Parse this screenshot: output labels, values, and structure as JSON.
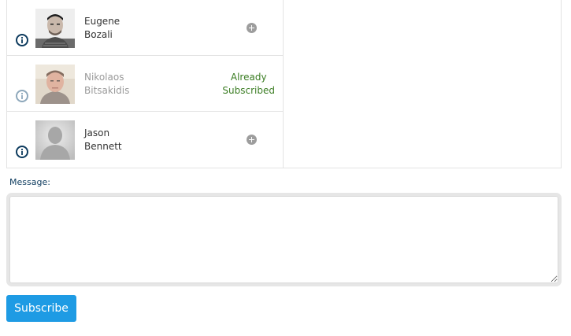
{
  "followers": [
    {
      "first_name": "Eugene",
      "last_name": "Bozali",
      "status": "add",
      "avatar_icon": "person-photo-icon"
    },
    {
      "first_name": "Nikolaos",
      "last_name": "Bitsakidis",
      "status": "subscribed",
      "status_line1": "Already",
      "status_line2": "Subscribed",
      "avatar_icon": "person-photo-icon"
    },
    {
      "first_name": "Jason",
      "last_name": "Bennett",
      "status": "add",
      "avatar_icon": "default-avatar-icon"
    }
  ],
  "message": {
    "label": "Message:",
    "value": ""
  },
  "subscribe_button": {
    "label": "Subscribe"
  },
  "colors": {
    "accent": "#1e9be4",
    "subscribed": "#3b7d23",
    "label": "#0d3b5e"
  }
}
